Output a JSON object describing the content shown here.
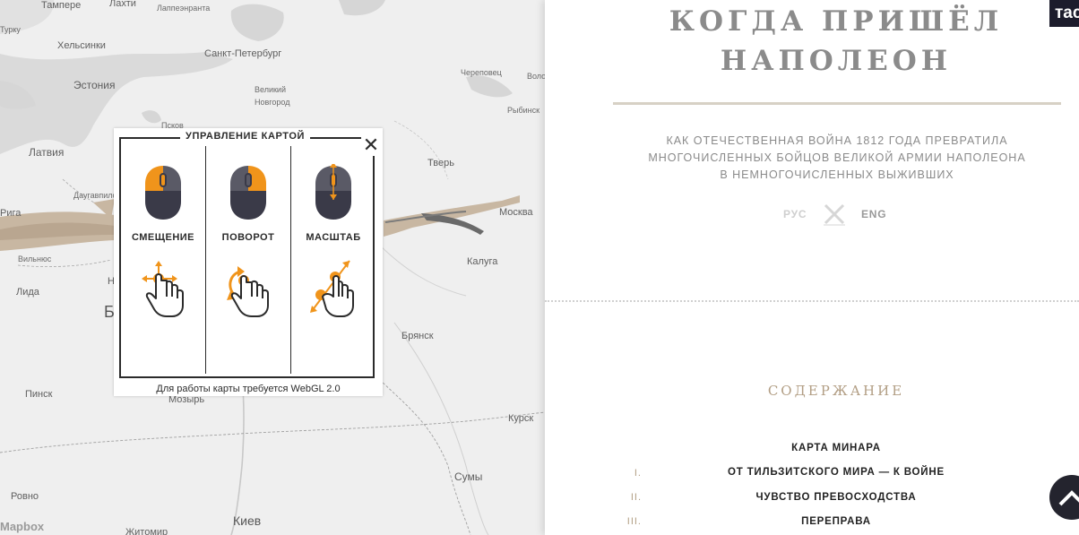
{
  "map": {
    "cities": [
      "Тампере",
      "Лахти",
      "Лаппеэнранта",
      "Хельсинки",
      "Санкт-Петербург",
      "Эстония",
      "Великий Новгород",
      "Череповец",
      "Вологда",
      "Рыбинск",
      "Псков",
      "Латвия",
      "Тверь",
      "Даугавпилс",
      "Москва",
      "Вильнюс",
      "Калуга",
      "Лида",
      "Брянск",
      "Пинск",
      "Мозырь",
      "Курск",
      "Ровно",
      "Сумы",
      "Киев",
      "Житомир",
      "Турку",
      "Рига",
      "Б",
      "Н"
    ],
    "attribution": "Mapbox"
  },
  "popup": {
    "title": "УПРАВЛЕНИЕ КАРТОЙ",
    "close": "✕",
    "columns": [
      {
        "label": "СМЕЩЕНИЕ",
        "mouse_icon": "mouse-left-click-icon",
        "gesture_icon": "hand-pan-icon"
      },
      {
        "label": "ПОВОРОТ",
        "mouse_icon": "mouse-right-click-icon",
        "gesture_icon": "hand-rotate-icon"
      },
      {
        "label": "МАСШТАБ",
        "mouse_icon": "mouse-scroll-icon",
        "gesture_icon": "hand-pinch-icon"
      }
    ],
    "footer": "Для работы карты требуется WebGL 2.0",
    "accent_color": "#f0941b",
    "dark_color": "#3a3a48"
  },
  "panel": {
    "title_line1": "КОГДА ПРИШЁЛ",
    "title_line2": "НАПОЛЕОН",
    "subtitle_line1": "КАК ОТЕЧЕСТВЕННАЯ ВОЙНА 1812 ГОДА ПРЕВРАТИЛА",
    "subtitle_line2": "МНОГОЧИСЛЕННЫХ БОЙЦОВ ВЕЛИКОЙ АРМИИ НАПОЛЕОНА",
    "subtitle_line3": "В НЕМНОГОЧИСЛЕННЫХ ВЫЖИВШИХ",
    "lang_ru": "РУС",
    "lang_en": "ENG",
    "logo_text": "тас",
    "contents_title": "СОДЕРЖАНИЕ",
    "toc": [
      {
        "num": "",
        "title": "КАРТА МИНАРА"
      },
      {
        "num": "I.",
        "title": "ОТ ТИЛЬЗИТСКОГО МИРА — К ВОЙНЕ"
      },
      {
        "num": "II.",
        "title": "ЧУВСТВО ПРЕВОСХОДСТВА"
      },
      {
        "num": "III.",
        "title": "ПЕРЕПРАВА"
      }
    ],
    "title_color": "#8b8b8b",
    "accent_color": "#b29e84"
  }
}
